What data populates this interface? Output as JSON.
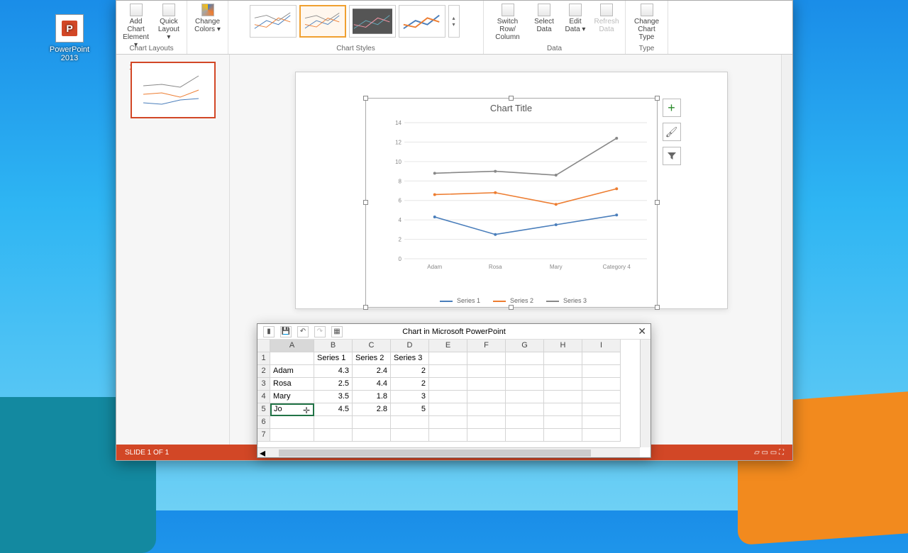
{
  "desktop": {
    "icon_label": "PowerPoint 2013",
    "icon_letter": "P"
  },
  "ribbon": {
    "groups": {
      "chart_layouts": {
        "label": "Chart Layouts",
        "add_element": "Add Chart Element ▾",
        "quick_layout": "Quick Layout ▾"
      },
      "chart_styles": {
        "label": "Chart Styles",
        "change_colors": "Change Colors ▾"
      },
      "data": {
        "label": "Data",
        "switch": "Switch Row/ Column",
        "select": "Select Data",
        "edit": "Edit Data ▾",
        "refresh": "Refresh Data"
      },
      "type": {
        "label": "Type",
        "change": "Change Chart Type"
      }
    }
  },
  "slide": {
    "number": "1"
  },
  "chart_data": {
    "type": "line",
    "title": "Chart Title",
    "categories": [
      "Adam",
      "Rosa",
      "Mary",
      "Category 4"
    ],
    "series": [
      {
        "name": "Series 1",
        "color": "#4a7ebb",
        "values": [
          4.3,
          2.5,
          3.5,
          4.5
        ]
      },
      {
        "name": "Series 2",
        "color": "#ed7d31",
        "values": [
          6.6,
          6.8,
          5.6,
          7.2
        ]
      },
      {
        "name": "Series 3",
        "color": "#888888",
        "values": [
          8.8,
          9.0,
          8.6,
          12.4
        ]
      }
    ],
    "ylim": [
      0,
      14
    ],
    "yticks": [
      0,
      2,
      4,
      6,
      8,
      10,
      12,
      14
    ]
  },
  "side_buttons": {
    "add": "+",
    "brush": "🖌",
    "filter": "▼"
  },
  "datasheet": {
    "title": "Chart in Microsoft PowerPoint",
    "cols": [
      "A",
      "B",
      "C",
      "D",
      "E",
      "F",
      "G",
      "H",
      "I"
    ],
    "rows": [
      "1",
      "2",
      "3",
      "4",
      "5",
      "6",
      "7"
    ],
    "header": [
      "",
      "Series 1",
      "Series 2",
      "Series 3"
    ],
    "data": [
      [
        "Adam",
        "4.3",
        "2.4",
        "2"
      ],
      [
        "Rosa",
        "2.5",
        "4.4",
        "2"
      ],
      [
        "Mary",
        "3.5",
        "1.8",
        "3"
      ],
      [
        "Jo",
        "4.5",
        "2.8",
        "5"
      ]
    ],
    "editing_cell": "Jo"
  },
  "status": {
    "left": "SLIDE 1 OF 1"
  }
}
